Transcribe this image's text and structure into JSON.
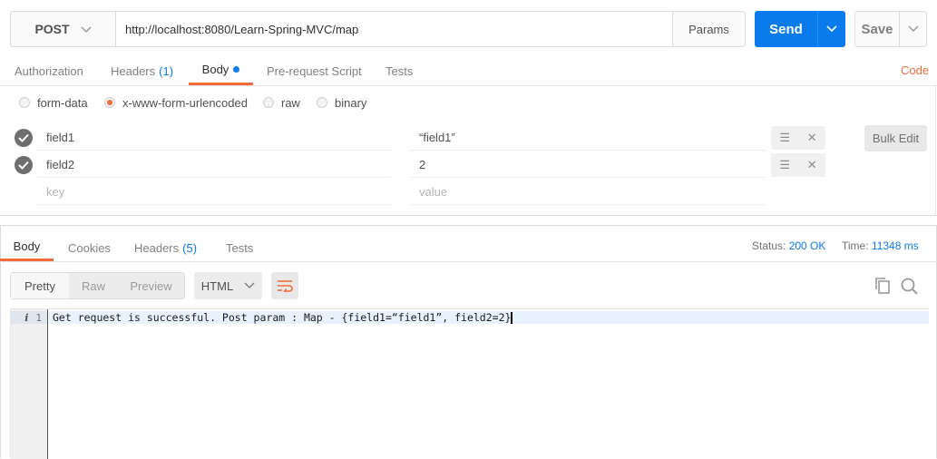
{
  "request": {
    "method": "POST",
    "url": "http://localhost:8080/Learn-Spring-MVC/map",
    "params_label": "Params",
    "send_label": "Send",
    "save_label": "Save"
  },
  "request_tabs": [
    {
      "label": "Authorization"
    },
    {
      "label": "Headers",
      "count": "(1)"
    },
    {
      "label": "Body"
    },
    {
      "label": "Pre-request Script"
    },
    {
      "label": "Tests"
    }
  ],
  "code_link": "Code",
  "body_types": [
    {
      "label": "form-data",
      "checked": false
    },
    {
      "label": "x-www-form-urlencoded",
      "checked": true
    },
    {
      "label": "raw",
      "checked": false
    },
    {
      "label": "binary",
      "checked": false
    }
  ],
  "form_rows": [
    {
      "key": "field1",
      "value": "“field1”",
      "enabled": true
    },
    {
      "key": "field2",
      "value": "2",
      "enabled": true
    }
  ],
  "new_row": {
    "key_placeholder": "key",
    "value_placeholder": "value"
  },
  "bulk_edit_label": "Bulk Edit",
  "response_tabs": [
    {
      "label": "Body"
    },
    {
      "label": "Cookies"
    },
    {
      "label": "Headers",
      "count": "(5)"
    },
    {
      "label": "Tests"
    }
  ],
  "response_status": {
    "status_label": "Status:",
    "status_value": "200 OK",
    "time_label": "Time:",
    "time_value": "11348 ms"
  },
  "view_modes": [
    {
      "label": "Pretty"
    },
    {
      "label": "Raw"
    },
    {
      "label": "Preview"
    }
  ],
  "format_select": "HTML",
  "editor": {
    "line_number": "1",
    "line_text": "Get request is successful. Post param : Map - {field1=“field1”, field2=2}"
  },
  "colors": {
    "accent": "#f26b3a",
    "send": "#097bed",
    "link": "#097bed"
  }
}
